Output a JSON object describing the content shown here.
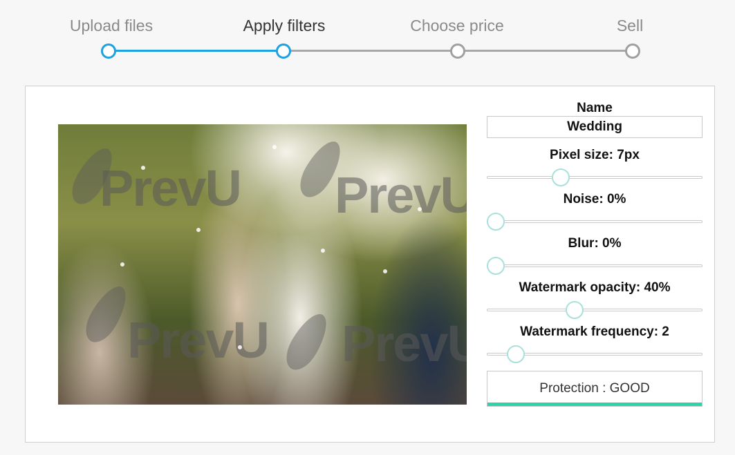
{
  "stepper": {
    "steps": [
      {
        "label": "Upload files",
        "state": "done"
      },
      {
        "label": "Apply filters",
        "state": "active"
      },
      {
        "label": "Choose price",
        "state": "todo"
      },
      {
        "label": "Sell",
        "state": "todo"
      }
    ],
    "colors": {
      "active": "#1da1e0",
      "inactive": "#a0a0a0"
    }
  },
  "preview": {
    "watermark_text": "PrevU"
  },
  "controls": {
    "name": {
      "label": "Name",
      "value": "Wedding"
    },
    "pixel_size": {
      "label": "Pixel size: 7px",
      "level": 0.33
    },
    "noise": {
      "label": "Noise: 0%",
      "level": 0.0
    },
    "blur": {
      "label": "Blur: 0%",
      "level": 0.0
    },
    "watermark_opacity": {
      "label": "Watermark opacity: 40%",
      "level": 0.4
    },
    "watermark_frequency": {
      "label": "Watermark frequency: 2",
      "level": 0.1
    },
    "protection": {
      "label": "Protection : GOOD",
      "level": 1.0,
      "color": "#2ed3a8"
    }
  }
}
